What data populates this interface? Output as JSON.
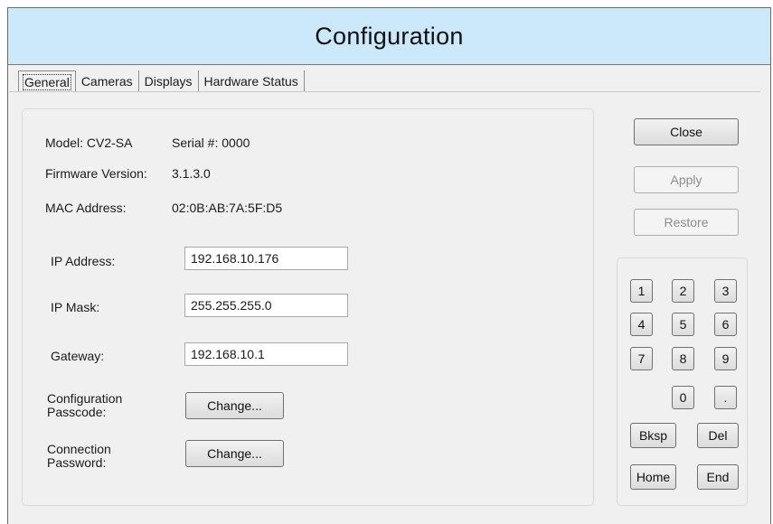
{
  "title": "Configuration",
  "tabs": [
    "General",
    "Cameras",
    "Displays",
    "Hardware Status"
  ],
  "general": {
    "model_label": "Model: CV2-SA",
    "serial_label": "Serial #: 0000",
    "firmware_label": "Firmware Version:",
    "firmware_value": "3.1.3.0",
    "mac_label": "MAC Address:",
    "mac_value": "02:0B:AB:7A:5F:D5",
    "ip_address_label": "IP Address:",
    "ip_address_value": "192.168.10.176",
    "ip_mask_label": "IP Mask:",
    "ip_mask_value": "255.255.255.0",
    "gateway_label": "Gateway:",
    "gateway_value": "192.168.10.1",
    "config_passcode_label_1": "Configuration",
    "config_passcode_label_2": "Passcode:",
    "connection_password_label_1": "Connection",
    "connection_password_label_2": "Password:",
    "change_label": "Change..."
  },
  "actions": {
    "close": "Close",
    "apply": "Apply",
    "restore": "Restore"
  },
  "keypad": {
    "k1": "1",
    "k2": "2",
    "k3": "3",
    "k4": "4",
    "k5": "5",
    "k6": "6",
    "k7": "7",
    "k8": "8",
    "k9": "9",
    "k0": "0",
    "kdot": ".",
    "bksp": "Bksp",
    "del": "Del",
    "home": "Home",
    "end": "End"
  }
}
